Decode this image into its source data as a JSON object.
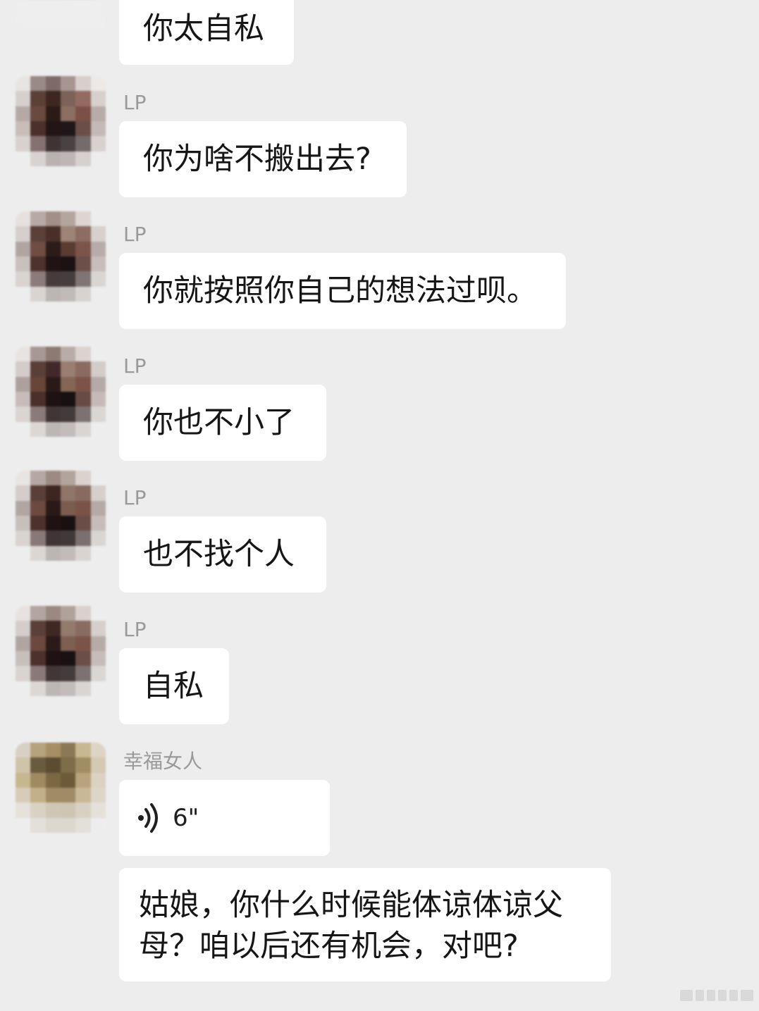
{
  "messages": [
    {
      "kind": "text",
      "avatar_colors": [
        "#d8cfc5",
        "#b5a27a",
        "#d1c4a7",
        "#8b7754",
        "#6b5a3c",
        "#d4c8ad",
        "#c6b89a",
        "#a28e67",
        "#e5dcc8",
        "#9e8a62",
        "#7d6a45",
        "#c8b690",
        "#d7d0c2",
        "#c9bda5",
        "#d6ccb4",
        "#b7a57f",
        "#a89675",
        "#d8d0c1",
        "#e2ddd6",
        "#d9d2c8",
        "#ded6ca",
        "#d0c5b2",
        "#c8bca6",
        "#e3dcd4",
        "#eeeeee",
        "#eeeeee",
        "#eeeeee",
        "#eeeeee",
        "#eeeeee",
        "#eeeeee",
        "#eeeeee",
        "#eeeeee",
        "#eeeeee",
        "#eeeeee",
        "#eeeeee",
        "#eeeeee"
      ],
      "sender": "",
      "text": "你太自私"
    },
    {
      "kind": "text",
      "avatar_colors": [
        "#e8e4e1",
        "#9a8a86",
        "#7e6b67",
        "#a69591",
        "#d7cfcc",
        "#ece9e7",
        "#d6d0cd",
        "#5c4038",
        "#3d2720",
        "#7c6258",
        "#946b62",
        "#d8d0cd",
        "#b4a9a5",
        "#6a4a40",
        "#2b1a16",
        "#8b6f62",
        "#7b5046",
        "#b7aca8",
        "#c8bdb9",
        "#4b312c",
        "#221515",
        "#1f1719",
        "#6b4e48",
        "#c3b9b6",
        "#d8d1ce",
        "#847271",
        "#3e3435",
        "#4a4143",
        "#746b6c",
        "#d7d2d0",
        "#ededed",
        "#d8d3d1",
        "#b9b2b1",
        "#bdb6b5",
        "#d6d0ce",
        "#ededed"
      ],
      "sender": "LP",
      "text": "你为啥不搬出去?"
    },
    {
      "kind": "text",
      "avatar_colors": [
        "#e6e1df",
        "#b7a9a4",
        "#a18f88",
        "#b5a59f",
        "#ddd5d1",
        "#ededed",
        "#d6cfcc",
        "#5b4039",
        "#4a2f29",
        "#9d8477",
        "#8c6c63",
        "#d7d0cd",
        "#b1a5a1",
        "#6f4d43",
        "#2c1b18",
        "#5a3c33",
        "#7b544a",
        "#b8acaa",
        "#c9bfbc",
        "#4c332d",
        "#201314",
        "#1b1214",
        "#6b4f49",
        "#c7bdba",
        "#d9d3d1",
        "#8b7c7b",
        "#463c3d",
        "#453d3e",
        "#7f7575",
        "#d9d5d3",
        "#ededed",
        "#d9d4d2",
        "#bbb5b4",
        "#c0bab9",
        "#d8d3d1",
        "#ededed"
      ],
      "sender": "LP",
      "text": "你就按照你自己的想法过呗。"
    },
    {
      "kind": "text",
      "avatar_colors": [
        "#e8e3e0",
        "#a89894",
        "#8d7a73",
        "#b9aba5",
        "#dcd3cf",
        "#ededed",
        "#d4ccc9",
        "#5a3f38",
        "#43282a",
        "#9a7e72",
        "#8b6a61",
        "#d4ccc9",
        "#ada19d",
        "#674538",
        "#2a1a17",
        "#836656",
        "#7c5349",
        "#b5aaa7",
        "#c7bcb9",
        "#49302a",
        "#1e1213",
        "#181011",
        "#684b45",
        "#c5bab7",
        "#dad4d2",
        "#8a7b7a",
        "#403637",
        "#423a3b",
        "#7c7272",
        "#dad6d4",
        "#ededed",
        "#dcd7d5",
        "#bcb6b5",
        "#c2bcbb",
        "#dad5d3",
        "#ededed"
      ],
      "sender": "LP",
      "text": "你也不小了"
    },
    {
      "kind": "text",
      "avatar_colors": [
        "#e8e4e1",
        "#b5a7a2",
        "#9c8a83",
        "#b3a39d",
        "#dbd2ce",
        "#ededed",
        "#d5cdca",
        "#5a3f38",
        "#3d2520",
        "#8f7669",
        "#896a61",
        "#d6cfcc",
        "#b1a6a2",
        "#6d4a40",
        "#2a1917",
        "#7a5d4f",
        "#7a5348",
        "#b6aaa7",
        "#c8beba",
        "#4b322c",
        "#1f1213",
        "#191012",
        "#6a4d47",
        "#c6bcb9",
        "#d9d3d1",
        "#887978",
        "#3f3536",
        "#403839",
        "#7a7070",
        "#d9d5d3",
        "#ededed",
        "#dbd6d4",
        "#bbb5b4",
        "#c1bbba",
        "#d9d4d2",
        "#ededed"
      ],
      "sender": "LP",
      "text": "也不找个人"
    },
    {
      "kind": "text",
      "avatar_colors": [
        "#e7e2df",
        "#b3a59f",
        "#9a8881",
        "#b1a19b",
        "#dad1cd",
        "#ededed",
        "#d5cdca",
        "#5b4039",
        "#3f2722",
        "#927a6c",
        "#8a6b62",
        "#d6cfcc",
        "#b0a5a1",
        "#6c493f",
        "#2b1a18",
        "#7d6051",
        "#7b5449",
        "#b7aba8",
        "#c8beba",
        "#4b322c",
        "#1f1213",
        "#1a1113",
        "#6b4e48",
        "#c6bcb9",
        "#d9d3d1",
        "#897a79",
        "#413738",
        "#433b3c",
        "#7c7272",
        "#dad6d4",
        "#ededed",
        "#dcd7d5",
        "#bcb6b5",
        "#c2bcbb",
        "#dad5d3",
        "#ededed"
      ],
      "sender": "LP",
      "text": "自私"
    },
    {
      "kind": "voice",
      "avatar_colors": [
        "#d9d0c4",
        "#b6a37c",
        "#a68f64",
        "#8c7854",
        "#c9b88f",
        "#ddd4c5",
        "#d0c4a8",
        "#6a5b3f",
        "#5c4c31",
        "#7f6c48",
        "#a18d63",
        "#d4c9b3",
        "#c7b78f",
        "#9f8a61",
        "#7b6742",
        "#6d5a38",
        "#b7a47c",
        "#dbd2c3",
        "#d6ccb9",
        "#c2b08b",
        "#a08b64",
        "#9f8b66",
        "#c9b898",
        "#ddd5c8",
        "#e6e1da",
        "#d9d1c4",
        "#d0c6b5",
        "#cfc5b3",
        "#d8d0c3",
        "#e5e0d9",
        "#ededed",
        "#e3dfd9",
        "#dcd7cf",
        "#dcd7cf",
        "#e3dfd9",
        "#ededed"
      ],
      "sender": "幸福女人",
      "duration": "6\""
    },
    {
      "kind": "text",
      "avatar_colors": [],
      "sender": "",
      "text": "姑娘，你什么时候能体谅体谅父母？咱以后还有机会，对吧?"
    }
  ]
}
